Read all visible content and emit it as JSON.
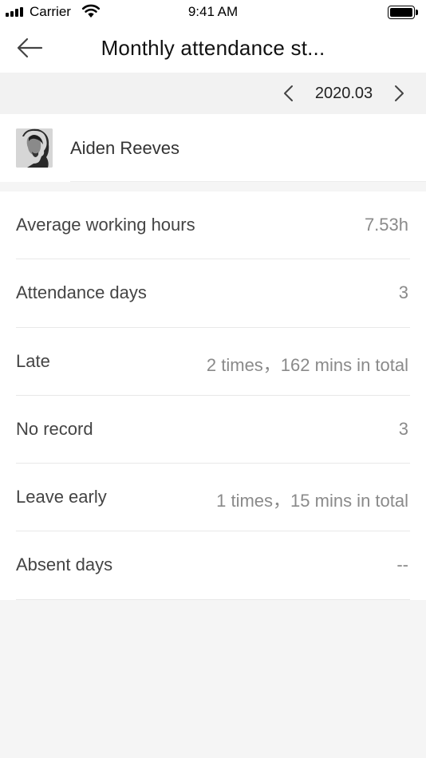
{
  "status_bar": {
    "carrier": "Carrier",
    "time": "9:41 AM",
    "signal_icon": "signal-bars-icon",
    "wifi_icon": "wifi-icon",
    "battery_icon": "battery-icon"
  },
  "nav": {
    "back_icon": "arrow-left-icon",
    "title": "Monthly attendance st..."
  },
  "month_selector": {
    "prev_icon": "chevron-left-icon",
    "month": "2020.03",
    "next_icon": "chevron-right-icon"
  },
  "user": {
    "name": "Aiden Reeves",
    "avatar_icon": "avatar-photo"
  },
  "stats": [
    {
      "label": "Average working hours",
      "value": "7.53h"
    },
    {
      "label": "Attendance days",
      "value": "3"
    },
    {
      "label": "Late",
      "value": "2 times，162 mins in total"
    },
    {
      "label": "No record",
      "value": "3"
    },
    {
      "label": "Leave early",
      "value": "1 times，15 mins in total"
    },
    {
      "label": "Absent days",
      "value": "--"
    }
  ],
  "colors": {
    "background": "#f5f5f5",
    "surface": "#ffffff",
    "label_text": "#444444",
    "value_text": "#8a8a8a",
    "divider": "#e8e8e8"
  }
}
